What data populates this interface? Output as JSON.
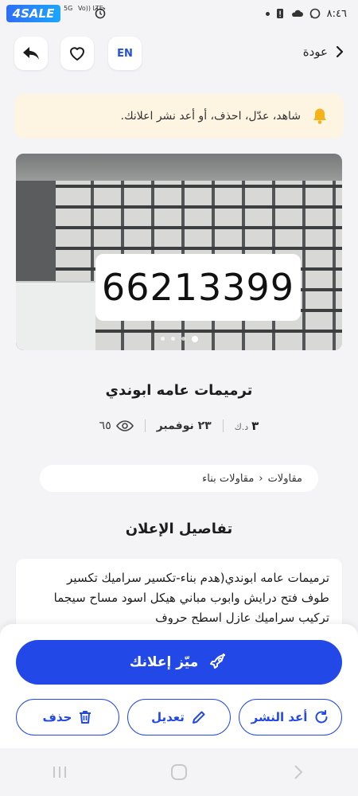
{
  "status_bar": {
    "logo": "4SALE",
    "network_labels": [
      "5G",
      "Vo)) LTE"
    ],
    "time": "٨:٤٦"
  },
  "header": {
    "back_label": "عودة",
    "language_label": "EN",
    "icons": [
      "share-icon",
      "heart-icon",
      "chevron-right-icon"
    ]
  },
  "notice": {
    "text": "شاهد، عدّل، احذف، أو أعد نشر اعلانك.",
    "icon": "bell-icon",
    "accent": "#f2b31b"
  },
  "gallery": {
    "phone_overlay": "66213399",
    "image_count": 4,
    "active_index": 0
  },
  "listing": {
    "title": "ترميمات عامه ابوندي",
    "price_value": "٣",
    "price_currency": "د.ك",
    "date": "٢٣ نوفمبر",
    "views": "٦٥",
    "breadcrumb": [
      "مقاولات",
      "مقاولات بناء"
    ]
  },
  "details": {
    "section_title": "تفاصيل الإعلان",
    "description_lines": [
      "ترميمات عامه ابوندي(هدم بناء-تكسير سراميك تكسير",
      "طوف فتح درايش وابوب مباني هيكل اسود مساح سيجما",
      "تركيب سراميك عازل اسطح حروف"
    ]
  },
  "actions": {
    "promote_label": "ميّز إعلانك",
    "republish_label": "أعد النشر",
    "edit_label": "تعديل",
    "delete_label": "حذف",
    "brand_color": "#2348e8"
  }
}
